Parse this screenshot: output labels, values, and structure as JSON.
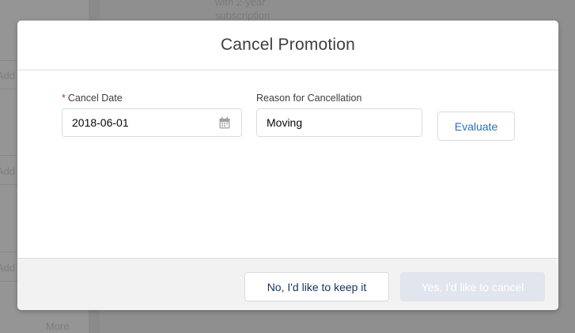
{
  "background": {
    "top_text_line1": "with 2-year",
    "top_text_line2": "subscription",
    "side_labels": [
      "Add",
      "Add",
      "Add"
    ],
    "more_link": "More"
  },
  "modal": {
    "title": "Cancel Promotion",
    "cancel_date": {
      "required_marker": "*",
      "label": "Cancel Date",
      "value": "2018-06-01",
      "icon": "calendar-icon"
    },
    "reason": {
      "label": "Reason for Cancellation",
      "value": "Moving"
    },
    "evaluate_label": "Evaluate",
    "footer": {
      "keep_label": "No, I'd like to keep it",
      "cancel_label": "Yes, I'd like to cancel"
    }
  },
  "colors": {
    "overlay": "#8f8f8f",
    "link_blue": "#0070d2",
    "disabled_button": "#e1e5ee",
    "required_red": "#c23934"
  }
}
